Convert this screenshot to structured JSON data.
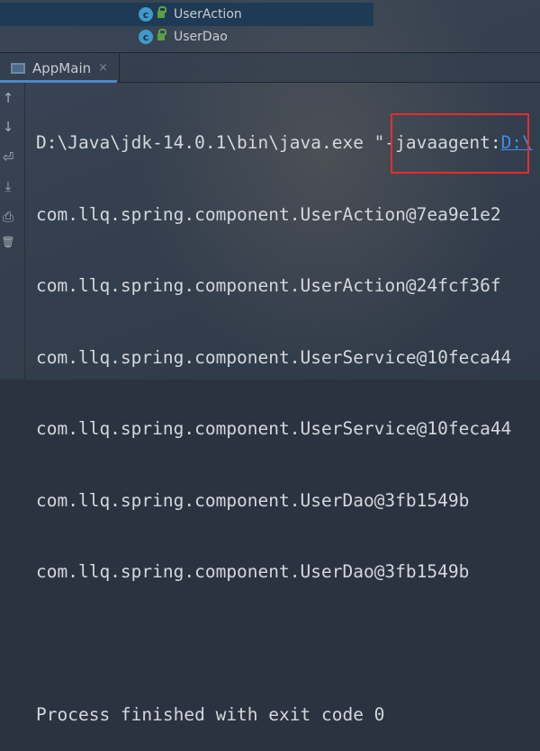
{
  "tree": {
    "items": [
      {
        "label": "UserAction",
        "icon": "class-icon",
        "selected": true
      },
      {
        "label": "UserDao",
        "icon": "class-icon",
        "selected": false
      }
    ],
    "class_glyph": "c"
  },
  "run_tab": {
    "label": "AppMain",
    "close": "×"
  },
  "gutter": {
    "up": "↑",
    "down": "↓",
    "wrap": "⏎",
    "scroll_end": "⤓",
    "print": "⎙",
    "clear": "🗑"
  },
  "console": {
    "command": "D:\\Java\\jdk-14.0.1\\bin\\java.exe \"-javaagent:",
    "command_link": "D:\\",
    "lines": [
      "com.llq.spring.component.UserAction@7ea9e1e2",
      "com.llq.spring.component.UserAction@24fcf36f",
      "com.llq.spring.component.UserService@10feca44",
      "com.llq.spring.component.UserService@10feca44",
      "com.llq.spring.component.UserDao@3fb1549b",
      "com.llq.spring.component.UserDao@3fb1549b"
    ],
    "exit": "Process finished with exit code 0"
  },
  "colors": {
    "highlight_box": "#e52d2d",
    "link": "#3e8ee6"
  }
}
